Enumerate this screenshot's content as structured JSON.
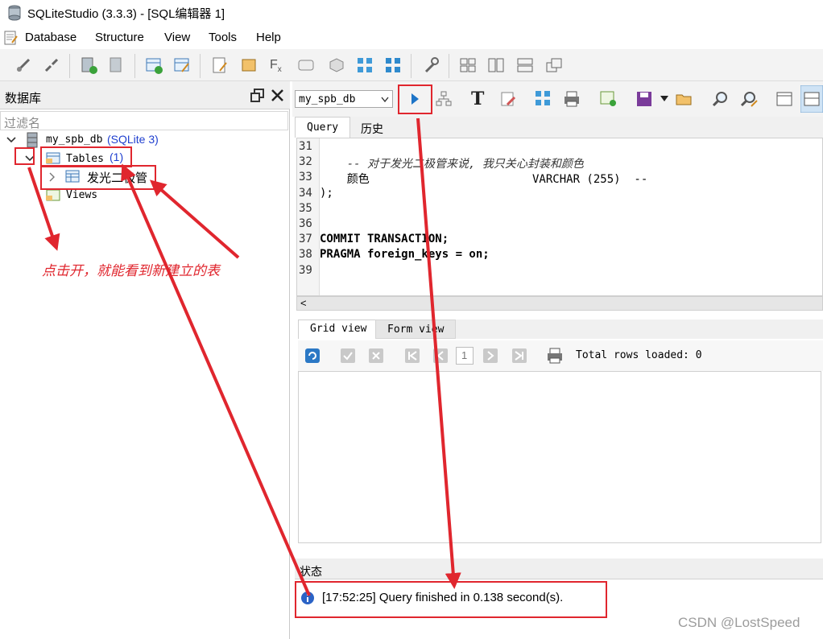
{
  "window": {
    "title": "SQLiteStudio (3.3.3) - [SQL编辑器 1]"
  },
  "menu": {
    "items": [
      "Database",
      "Structure",
      "View",
      "Tools",
      "Help"
    ]
  },
  "dock": {
    "title": "数据库",
    "filter_placeholder": "过滤名",
    "tree": {
      "db_name": "my_spb_db",
      "db_type": "(SQLite 3)",
      "tables_label": "Tables",
      "tables_count": "(1)",
      "table_name": "发光二极管",
      "views_label": "Views"
    }
  },
  "editor": {
    "db_combo_value": "my_spb_db",
    "tabs": [
      "Query",
      "历史"
    ],
    "lines": [
      {
        "n": "31",
        "text": ""
      },
      {
        "n": "32",
        "text": "    -- 对于发光二极管来说, 我只关心封装和颜色"
      },
      {
        "n": "33",
        "text": "    颜色                        VARCHAR (255)  --"
      },
      {
        "n": "34",
        "text": ");"
      },
      {
        "n": "35",
        "text": ""
      },
      {
        "n": "36",
        "text": ""
      },
      {
        "n": "37",
        "text": "COMMIT TRANSACTION;"
      },
      {
        "n": "38",
        "text": "PRAGMA foreign_keys = on;"
      },
      {
        "n": "39",
        "text": ""
      }
    ]
  },
  "results": {
    "tabs": [
      "Grid view",
      "Form view"
    ],
    "page": "1",
    "total_rows": "Total rows loaded: 0"
  },
  "status": {
    "title": "状态",
    "message": "[17:52:25]  Query finished in 0.138 second(s)."
  },
  "annotation": {
    "text": "点击开，就能看到新建立的表",
    "color": "#e0262e"
  },
  "watermark": "CSDN @LostSpeed"
}
